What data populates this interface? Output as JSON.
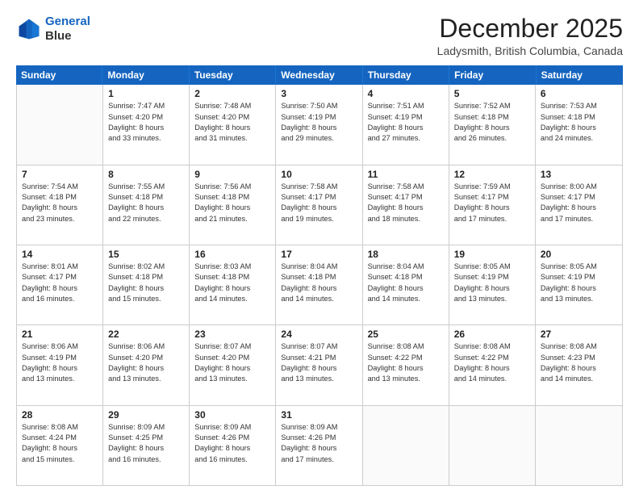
{
  "logo": {
    "line1": "General",
    "line2": "Blue"
  },
  "title": "December 2025",
  "location": "Ladysmith, British Columbia, Canada",
  "header_days": [
    "Sunday",
    "Monday",
    "Tuesday",
    "Wednesday",
    "Thursday",
    "Friday",
    "Saturday"
  ],
  "weeks": [
    [
      {
        "day": "",
        "lines": []
      },
      {
        "day": "1",
        "lines": [
          "Sunrise: 7:47 AM",
          "Sunset: 4:20 PM",
          "Daylight: 8 hours",
          "and 33 minutes."
        ]
      },
      {
        "day": "2",
        "lines": [
          "Sunrise: 7:48 AM",
          "Sunset: 4:20 PM",
          "Daylight: 8 hours",
          "and 31 minutes."
        ]
      },
      {
        "day": "3",
        "lines": [
          "Sunrise: 7:50 AM",
          "Sunset: 4:19 PM",
          "Daylight: 8 hours",
          "and 29 minutes."
        ]
      },
      {
        "day": "4",
        "lines": [
          "Sunrise: 7:51 AM",
          "Sunset: 4:19 PM",
          "Daylight: 8 hours",
          "and 27 minutes."
        ]
      },
      {
        "day": "5",
        "lines": [
          "Sunrise: 7:52 AM",
          "Sunset: 4:18 PM",
          "Daylight: 8 hours",
          "and 26 minutes."
        ]
      },
      {
        "day": "6",
        "lines": [
          "Sunrise: 7:53 AM",
          "Sunset: 4:18 PM",
          "Daylight: 8 hours",
          "and 24 minutes."
        ]
      }
    ],
    [
      {
        "day": "7",
        "lines": [
          "Sunrise: 7:54 AM",
          "Sunset: 4:18 PM",
          "Daylight: 8 hours",
          "and 23 minutes."
        ]
      },
      {
        "day": "8",
        "lines": [
          "Sunrise: 7:55 AM",
          "Sunset: 4:18 PM",
          "Daylight: 8 hours",
          "and 22 minutes."
        ]
      },
      {
        "day": "9",
        "lines": [
          "Sunrise: 7:56 AM",
          "Sunset: 4:18 PM",
          "Daylight: 8 hours",
          "and 21 minutes."
        ]
      },
      {
        "day": "10",
        "lines": [
          "Sunrise: 7:58 AM",
          "Sunset: 4:17 PM",
          "Daylight: 8 hours",
          "and 19 minutes."
        ]
      },
      {
        "day": "11",
        "lines": [
          "Sunrise: 7:58 AM",
          "Sunset: 4:17 PM",
          "Daylight: 8 hours",
          "and 18 minutes."
        ]
      },
      {
        "day": "12",
        "lines": [
          "Sunrise: 7:59 AM",
          "Sunset: 4:17 PM",
          "Daylight: 8 hours",
          "and 17 minutes."
        ]
      },
      {
        "day": "13",
        "lines": [
          "Sunrise: 8:00 AM",
          "Sunset: 4:17 PM",
          "Daylight: 8 hours",
          "and 17 minutes."
        ]
      }
    ],
    [
      {
        "day": "14",
        "lines": [
          "Sunrise: 8:01 AM",
          "Sunset: 4:17 PM",
          "Daylight: 8 hours",
          "and 16 minutes."
        ]
      },
      {
        "day": "15",
        "lines": [
          "Sunrise: 8:02 AM",
          "Sunset: 4:18 PM",
          "Daylight: 8 hours",
          "and 15 minutes."
        ]
      },
      {
        "day": "16",
        "lines": [
          "Sunrise: 8:03 AM",
          "Sunset: 4:18 PM",
          "Daylight: 8 hours",
          "and 14 minutes."
        ]
      },
      {
        "day": "17",
        "lines": [
          "Sunrise: 8:04 AM",
          "Sunset: 4:18 PM",
          "Daylight: 8 hours",
          "and 14 minutes."
        ]
      },
      {
        "day": "18",
        "lines": [
          "Sunrise: 8:04 AM",
          "Sunset: 4:18 PM",
          "Daylight: 8 hours",
          "and 14 minutes."
        ]
      },
      {
        "day": "19",
        "lines": [
          "Sunrise: 8:05 AM",
          "Sunset: 4:19 PM",
          "Daylight: 8 hours",
          "and 13 minutes."
        ]
      },
      {
        "day": "20",
        "lines": [
          "Sunrise: 8:05 AM",
          "Sunset: 4:19 PM",
          "Daylight: 8 hours",
          "and 13 minutes."
        ]
      }
    ],
    [
      {
        "day": "21",
        "lines": [
          "Sunrise: 8:06 AM",
          "Sunset: 4:19 PM",
          "Daylight: 8 hours",
          "and 13 minutes."
        ]
      },
      {
        "day": "22",
        "lines": [
          "Sunrise: 8:06 AM",
          "Sunset: 4:20 PM",
          "Daylight: 8 hours",
          "and 13 minutes."
        ]
      },
      {
        "day": "23",
        "lines": [
          "Sunrise: 8:07 AM",
          "Sunset: 4:20 PM",
          "Daylight: 8 hours",
          "and 13 minutes."
        ]
      },
      {
        "day": "24",
        "lines": [
          "Sunrise: 8:07 AM",
          "Sunset: 4:21 PM",
          "Daylight: 8 hours",
          "and 13 minutes."
        ]
      },
      {
        "day": "25",
        "lines": [
          "Sunrise: 8:08 AM",
          "Sunset: 4:22 PM",
          "Daylight: 8 hours",
          "and 13 minutes."
        ]
      },
      {
        "day": "26",
        "lines": [
          "Sunrise: 8:08 AM",
          "Sunset: 4:22 PM",
          "Daylight: 8 hours",
          "and 14 minutes."
        ]
      },
      {
        "day": "27",
        "lines": [
          "Sunrise: 8:08 AM",
          "Sunset: 4:23 PM",
          "Daylight: 8 hours",
          "and 14 minutes."
        ]
      }
    ],
    [
      {
        "day": "28",
        "lines": [
          "Sunrise: 8:08 AM",
          "Sunset: 4:24 PM",
          "Daylight: 8 hours",
          "and 15 minutes."
        ]
      },
      {
        "day": "29",
        "lines": [
          "Sunrise: 8:09 AM",
          "Sunset: 4:25 PM",
          "Daylight: 8 hours",
          "and 16 minutes."
        ]
      },
      {
        "day": "30",
        "lines": [
          "Sunrise: 8:09 AM",
          "Sunset: 4:26 PM",
          "Daylight: 8 hours",
          "and 16 minutes."
        ]
      },
      {
        "day": "31",
        "lines": [
          "Sunrise: 8:09 AM",
          "Sunset: 4:26 PM",
          "Daylight: 8 hours",
          "and 17 minutes."
        ]
      },
      {
        "day": "",
        "lines": []
      },
      {
        "day": "",
        "lines": []
      },
      {
        "day": "",
        "lines": []
      }
    ]
  ]
}
